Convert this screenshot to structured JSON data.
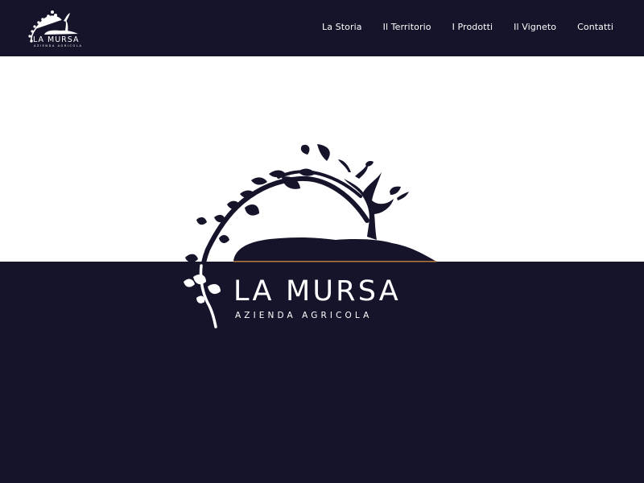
{
  "brand": {
    "name": "LA MURSA",
    "tagline": "AZIENDA AGRICOLA"
  },
  "nav": {
    "items": [
      {
        "label": "La Storia"
      },
      {
        "label": "Il Territorio"
      },
      {
        "label": "I Prodotti"
      },
      {
        "label": "Il Vigneto"
      },
      {
        "label": "Contatti"
      }
    ]
  },
  "hero": {
    "title": "LA MURSA",
    "subtitle": "AZIENDA AGRICOLA"
  },
  "colors": {
    "navy": "#15142b",
    "white": "#ffffff",
    "accent_line": "#b97a3f"
  },
  "icons": {
    "logo": "vine-tree-icon"
  }
}
